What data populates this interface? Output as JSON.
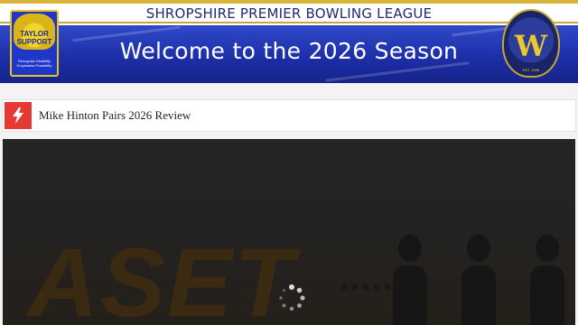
{
  "banner": {
    "league_title": "SHROPSHIRE PREMIER BOWLING LEAGUE",
    "welcome_text": "Welcome to the 2026 Season",
    "sponsor_logo": {
      "name": "TAYLOR SUPPORT",
      "line1": "TAYLOR",
      "line2": "SUPPORT",
      "tagline1": "Recognise Disability",
      "tagline2": "Emphasise Possibility"
    },
    "crest": {
      "letter": "W",
      "est": "EST. 1995"
    }
  },
  "ticker": {
    "icon": "lightning-bolt-icon",
    "headline": "Mike Hinton Pairs 2026 Review"
  },
  "media": {
    "background_word": "ASET",
    "state": "loading"
  },
  "colors": {
    "banner_blue": "#1d2fa8",
    "banner_gold": "#d8b43a",
    "ticker_red": "#e53935",
    "media_dark": "#222222"
  }
}
